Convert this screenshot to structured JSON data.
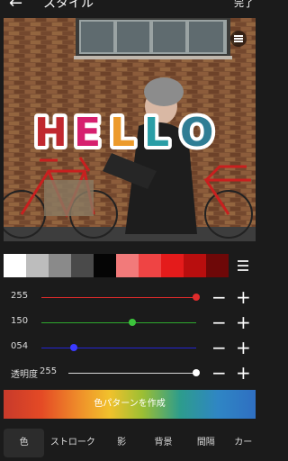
{
  "header": {
    "back_icon": "arrow-left-icon",
    "title": "スタイル",
    "done_label": "完了"
  },
  "preview": {
    "overlay_text": "HELLO",
    "menu_icon": "hamburger-icon"
  },
  "palette": {
    "colors": [
      "#ffffff",
      "#bdbdbd",
      "#8a8a8a",
      "#4a4a4a",
      "#050505",
      "#f27a7a",
      "#ef4444",
      "#e41b1b",
      "#b80e0e",
      "#6e0808"
    ],
    "menu_icon": "hamburger-icon"
  },
  "sliders": [
    {
      "label": "255",
      "color": "#e02b2b",
      "knob_color": "#e02b2b",
      "value": 255,
      "max": 255
    },
    {
      "label": "150",
      "color": "#2ea82e",
      "knob_color": "#3cc43c",
      "value": 150,
      "max": 255
    },
    {
      "label": "054",
      "color": "#2323d2",
      "knob_color": "#3a3aff",
      "value": 54,
      "max": 255
    }
  ],
  "opacity": {
    "label": "透明度",
    "value_label": "255",
    "value": 255,
    "max": 255
  },
  "controls": {
    "minus": "−",
    "plus": "+"
  },
  "pattern_button": {
    "label": "色パターンを作成"
  },
  "tabs": [
    "色",
    "ストローク",
    "影",
    "背景",
    "間隔",
    "カー"
  ]
}
